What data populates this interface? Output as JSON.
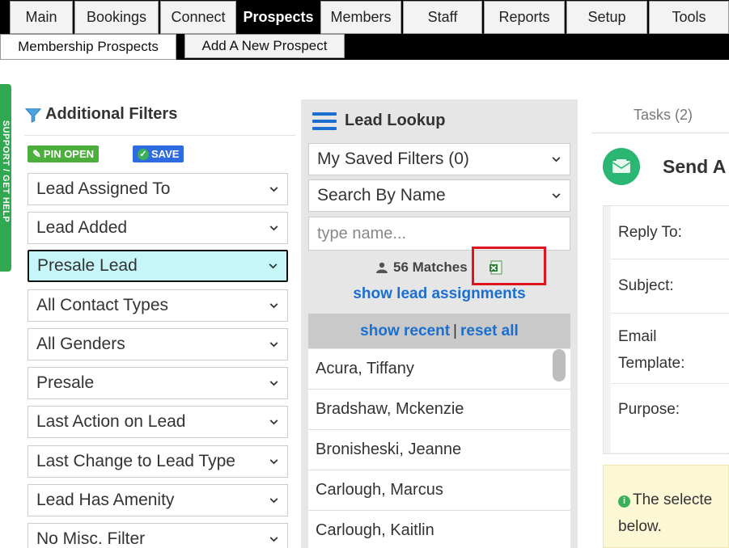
{
  "top_nav": {
    "tabs": [
      "Main",
      "Bookings",
      "Connect",
      "Prospects",
      "Members",
      "Staff",
      "Reports",
      "Setup",
      "Tools"
    ],
    "active": "Prospects"
  },
  "sub_nav": {
    "tabs": [
      "Membership Prospects",
      "Add A New Prospect"
    ],
    "active": "Membership Prospects"
  },
  "support_tab": "SUPPORT / GET HELP",
  "filters": {
    "title": "Additional Filters",
    "pin_label": "PIN OPEN",
    "save_label": "SAVE",
    "selects": [
      "Lead Assigned To",
      "Lead Added",
      "Presale Lead",
      "All Contact Types",
      "All Genders",
      "Presale",
      "Last Action on Lead",
      "Last Change to Lead Type",
      "Lead Has Amenity",
      "No Misc. Filter"
    ],
    "highlighted": "Presale Lead"
  },
  "lookup": {
    "title": "Lead Lookup",
    "saved_filters": "My Saved Filters (0)",
    "search_by": "Search By Name",
    "name_placeholder": "type name...",
    "matches": "56 Matches",
    "show_assignments": "show lead assignments",
    "show_recent": "show recent",
    "separator": "|",
    "reset_all": "reset all",
    "leads": [
      "Acura, Tiffany",
      "Bradshaw, Mckenzie",
      "Bronisheski, Jeanne",
      "Carlough, Marcus",
      "Carlough, Kaitlin"
    ]
  },
  "right_panel": {
    "tasks_tab": "Tasks (2)",
    "title": "Send A",
    "fields": [
      "Reply To:",
      "Subject:",
      "Email",
      "Template:",
      "Purpose:"
    ],
    "notice_line1": "The selecte",
    "notice_line2": "below."
  },
  "colors": {
    "link_blue": "#1a6fd0",
    "highlight_cyan": "#c6f6f7",
    "annotation_red": "#e0141e",
    "green": "#2bb673"
  },
  "icons": {
    "filter": "funnel-icon",
    "menu": "hamburger-icon",
    "users": "users-icon",
    "export": "excel-export-icon",
    "email": "envelope-icon",
    "info": "info-icon"
  }
}
